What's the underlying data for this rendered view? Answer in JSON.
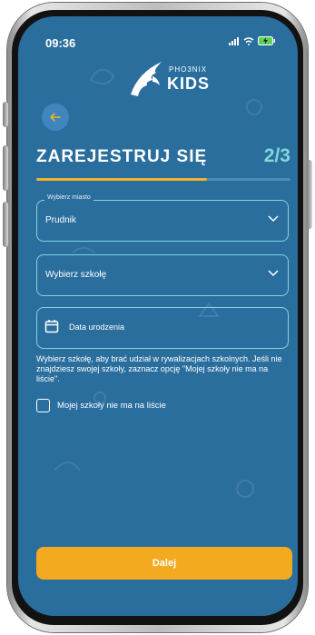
{
  "status_bar": {
    "time": "09:36"
  },
  "logo": {
    "top_text": "PHO3NIX",
    "main_text": "KIDS"
  },
  "header": {
    "title": "ZAREJESTRUJ SIĘ",
    "step": "2/3",
    "progress": 0.67
  },
  "form": {
    "city": {
      "label": "Wybierz miasto",
      "value": "Prudnik"
    },
    "school": {
      "placeholder": "Wybierz szkołę"
    },
    "birth_date": {
      "placeholder": "Data urodzenia"
    },
    "info_text": "Wybierz szkołę, aby brać udział w rywalizacjach szkolnych. Jeśli nie znajdziesz swojej szkoły, zaznacz opcję \"Mojej szkoły nie ma na liście\".",
    "no_school_checkbox": {
      "label": "Mojej szkoły nie ma na liście",
      "checked": false
    }
  },
  "actions": {
    "next_label": "Dalej"
  },
  "colors": {
    "background": "#2a6e9e",
    "accent_orange": "#f4aa1f",
    "accent_cyan": "#7fd8dc"
  }
}
